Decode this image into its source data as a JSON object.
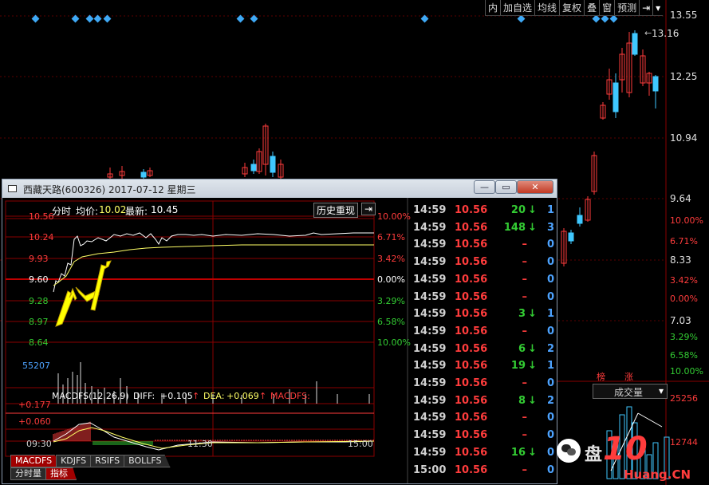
{
  "toolbar": {
    "items": [
      "内",
      "加自选",
      "均线",
      "复权",
      "叠",
      "窗",
      "预测"
    ]
  },
  "main_chart": {
    "max_label": "13.16",
    "price_axis": [
      "13.55",
      "12.25",
      "10.94",
      "9.64",
      "8.33",
      "7.03"
    ],
    "percent_axis": [
      "10.00%",
      "6.71%",
      "3.42%",
      "0.00%",
      "3.29%",
      "6.58%",
      "10.00%"
    ]
  },
  "badges": {
    "b1": "榜",
    "b2": "涨"
  },
  "volume_panel": {
    "selector": "成交量",
    "labels": [
      "25256",
      "12744"
    ]
  },
  "popup": {
    "title": "西藏天路(600326) 2017-07-12 星期三",
    "header": {
      "mode": "分时",
      "avg_label": "均价:",
      "avg_value": "10.02",
      "latest_label": "最新:",
      "latest_value": "10.45",
      "history_button": "历史重现"
    },
    "price_left": [
      "10.56",
      "10.24",
      "9.93",
      "9.60",
      "9.28",
      "8.97",
      "8.64"
    ],
    "pct_right": [
      "10.00%",
      "6.71%",
      "3.42%",
      "0.00%",
      "3.29%",
      "6.58%",
      "10.00%"
    ],
    "vol_label": "55207",
    "macd": {
      "title": "MACDFS(12,26,9)",
      "diff_label": "DIFF:",
      "diff_value": "+0.105",
      "dea_label": "DEA:",
      "dea_value": "+0.069",
      "macdfs_label": "MACDFS:",
      "axis": [
        "+0.177",
        "+0.060"
      ]
    },
    "time_axis": [
      "09:30",
      "11:30",
      "15:00"
    ],
    "tabs": [
      "MACDFS",
      "KDJFS",
      "RSIFS",
      "BOLLFS"
    ],
    "tabs2": [
      "分时量",
      "指标"
    ],
    "ticks": [
      {
        "time": "14:59",
        "price": "10.56",
        "vol": "20",
        "dir": "down",
        "n": "1"
      },
      {
        "time": "14:59",
        "price": "10.56",
        "vol": "148",
        "dir": "down",
        "n": "3"
      },
      {
        "time": "14:59",
        "price": "10.56",
        "vol": "–",
        "dir": "",
        "n": "0"
      },
      {
        "time": "14:59",
        "price": "10.56",
        "vol": "–",
        "dir": "",
        "n": "0"
      },
      {
        "time": "14:59",
        "price": "10.56",
        "vol": "–",
        "dir": "",
        "n": "0"
      },
      {
        "time": "14:59",
        "price": "10.56",
        "vol": "–",
        "dir": "",
        "n": "0"
      },
      {
        "time": "14:59",
        "price": "10.56",
        "vol": "3",
        "dir": "down",
        "n": "1"
      },
      {
        "time": "14:59",
        "price": "10.56",
        "vol": "–",
        "dir": "",
        "n": "0"
      },
      {
        "time": "14:59",
        "price": "10.56",
        "vol": "6",
        "dir": "down",
        "n": "2"
      },
      {
        "time": "14:59",
        "price": "10.56",
        "vol": "19",
        "dir": "down",
        "n": "1"
      },
      {
        "time": "14:59",
        "price": "10.56",
        "vol": "–",
        "dir": "",
        "n": "0"
      },
      {
        "time": "14:59",
        "price": "10.56",
        "vol": "8",
        "dir": "down",
        "n": "2"
      },
      {
        "time": "14:59",
        "price": "10.56",
        "vol": "–",
        "dir": "",
        "n": "0"
      },
      {
        "time": "14:59",
        "price": "10.56",
        "vol": "–",
        "dir": "",
        "n": "0"
      },
      {
        "time": "14:59",
        "price": "10.56",
        "vol": "16",
        "dir": "down",
        "n": "0"
      },
      {
        "time": "15:00",
        "price": "10.56",
        "vol": "–",
        "dir": "",
        "n": "0"
      }
    ]
  },
  "watermark": {
    "text1": "盘",
    "text2": "10",
    "text3": "Huang.CN"
  }
}
